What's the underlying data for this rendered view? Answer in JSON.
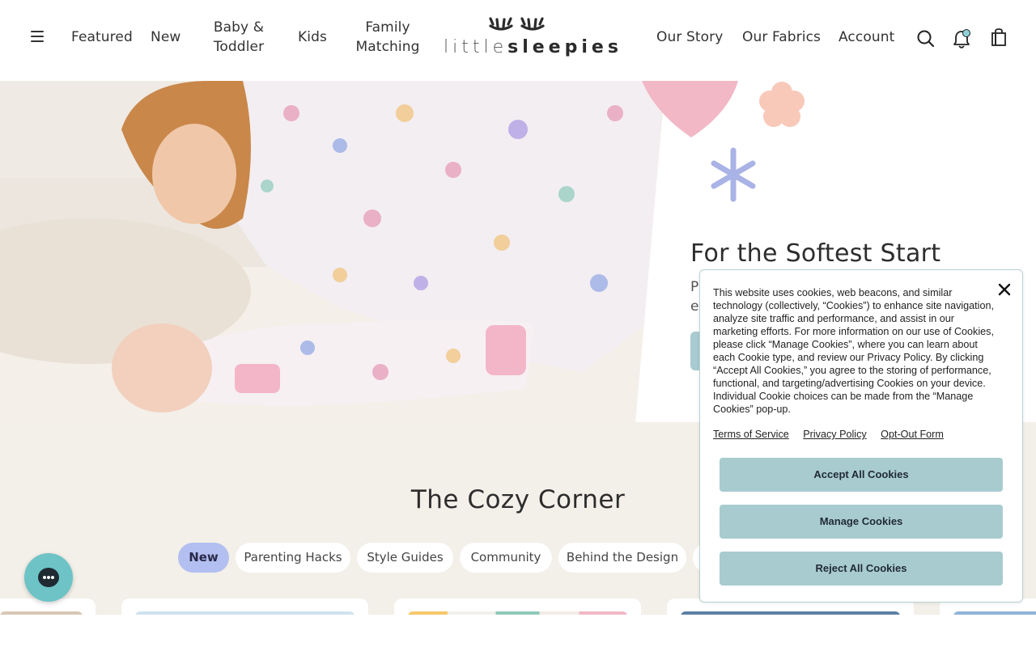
{
  "header": {
    "nav_left": [
      {
        "label": "Featured"
      },
      {
        "label": "New"
      },
      {
        "label_line1": "Baby &",
        "label_line2": "Toddler"
      },
      {
        "label": "Kids"
      },
      {
        "label_line1": "Family",
        "label_line2": "Matching"
      }
    ],
    "logo": {
      "light": "little",
      "bold": "sleepies"
    },
    "nav_right": [
      {
        "label": "Our Story"
      },
      {
        "label": "Our Fabrics"
      },
      {
        "label": "Account"
      }
    ],
    "icons": [
      "menu-icon",
      "search-icon",
      "bell-icon",
      "shopping-bag-icon"
    ],
    "notification_dot_color": "#8fd0d8"
  },
  "hero": {
    "title": "For the Softest Start",
    "subtitle_partial_line1": "P",
    "subtitle_partial_line2": "e",
    "accent_colors": {
      "heart": "#f2b8c6",
      "flower": "#f8c9b9",
      "star": "#a9b3e6",
      "button": "#a8cbd0"
    }
  },
  "cozy_corner": {
    "title": "The Cozy Corner",
    "filters": [
      {
        "label": "New",
        "active": true
      },
      {
        "label": "Parenting Hacks",
        "active": false
      },
      {
        "label": "Style Guides",
        "active": false
      },
      {
        "label": "Community",
        "active": false
      },
      {
        "label": "Behind the Design",
        "active": false
      }
    ]
  },
  "cookie_banner": {
    "text": "This website uses cookies, web beacons, and similar technology (collectively, “Cookies”) to enhance site navigation, analyze site traffic and performance, and assist in our marketing efforts. For more information on our use of Cookies, please click “Manage Cookies”, where you can learn about each Cookie type, and review our Privacy Policy. By clicking “Accept All Cookies,” you agree to the storing of performance, functional, and targeting/advertising Cookies on your device. Individual Cookie choices can be made from the “Manage Cookies” pop-up.",
    "links": [
      "Terms of Service",
      "Privacy Policy",
      "Opt-Out Form"
    ],
    "buttons": {
      "accept": "Accept All Cookies",
      "manage": "Manage Cookies",
      "reject": "Reject All Cookies"
    }
  },
  "chat": {
    "icon": "chat-bubble-icon",
    "color": "#6dc3c6"
  }
}
